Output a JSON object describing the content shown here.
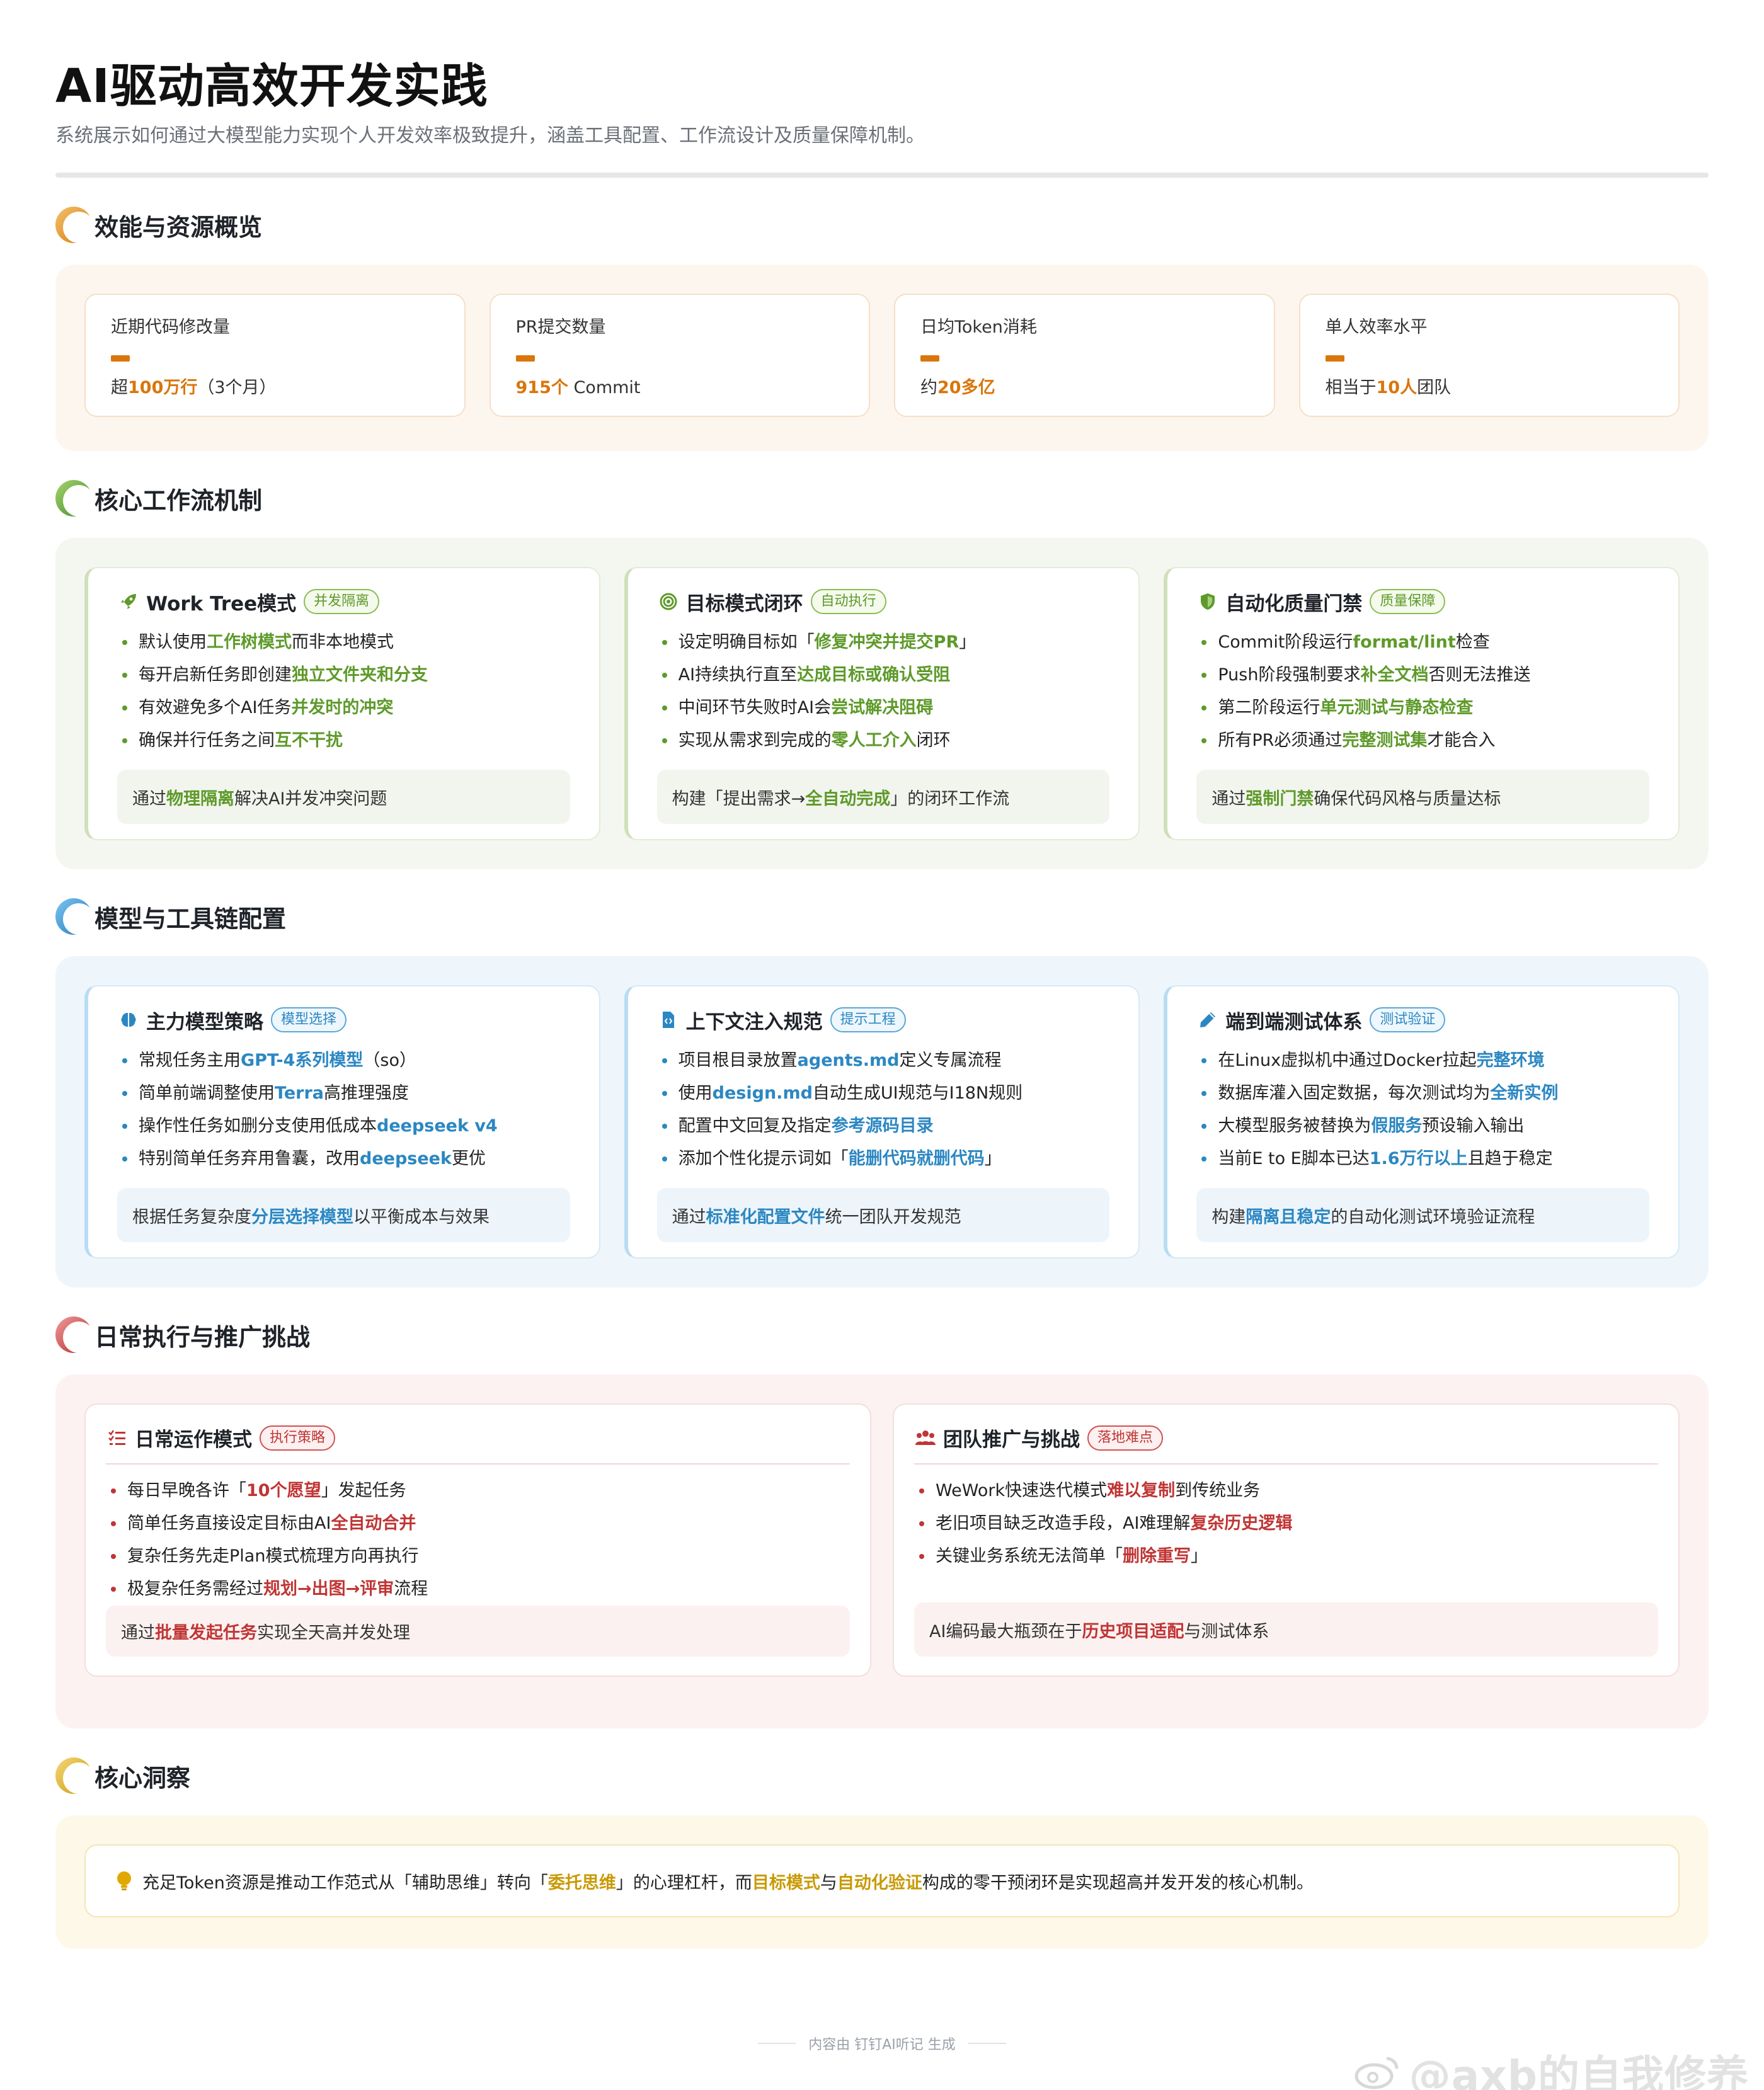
{
  "header": {
    "title": "AI驱动高效开发实践",
    "subtitle": "系统展示如何通过大模型能力实现个人开发效率极致提升，涵盖工具配置、工作流设计及质量保障机制。"
  },
  "sections": {
    "overview": {
      "title": "效能与资源概览",
      "stats": [
        {
          "label": "近期代码修改量",
          "pre": "超",
          "hl": "100万行",
          "post": "（3个月）"
        },
        {
          "label": "PR提交数量",
          "pre": "",
          "hl": "915个",
          "post": " Commit"
        },
        {
          "label": "日均Token消耗",
          "pre": "约",
          "hl": "20多亿",
          "post": ""
        },
        {
          "label": "单人效率水平",
          "pre": "相当于",
          "hl": "10人",
          "post": "团队"
        }
      ]
    },
    "workflow": {
      "title": "核心工作流机制",
      "cards": [
        {
          "icon": "rocket-icon",
          "title": "Work Tree模式",
          "tag": "并发隔离",
          "items": [
            [
              "默认使用",
              "工作树模式",
              "而非本地模式"
            ],
            [
              "每开启新任务即创建",
              "独立文件夹和分支",
              ""
            ],
            [
              "有效避免多个AI任务",
              "并发时的冲突",
              ""
            ],
            [
              "确保并行任务之间",
              "互不干扰",
              ""
            ]
          ],
          "note": [
            "通过",
            "物理隔离",
            "解决AI并发冲突问题"
          ]
        },
        {
          "icon": "target-icon",
          "title": "目标模式闭环",
          "tag": "自动执行",
          "items": [
            [
              "设定明确目标如「",
              "修复冲突并提交PR",
              "」"
            ],
            [
              "AI持续执行直至",
              "达成目标或确认受阻",
              ""
            ],
            [
              "中间环节失败时AI会",
              "尝试解决阻碍",
              ""
            ],
            [
              "实现从需求到完成的",
              "零人工介入",
              "闭环"
            ]
          ],
          "note": [
            "构建「提出需求→",
            "全自动完成",
            "」的闭环工作流"
          ]
        },
        {
          "icon": "shield-icon",
          "title": "自动化质量门禁",
          "tag": "质量保障",
          "items": [
            [
              "Commit阶段运行",
              "format/lint",
              "检查"
            ],
            [
              "Push阶段强制要求",
              "补全文档",
              "否则无法推送"
            ],
            [
              "第二阶段运行",
              "单元测试与静态检查",
              ""
            ],
            [
              "所有PR必须通过",
              "完整测试集",
              "才能合入"
            ]
          ],
          "note": [
            "通过",
            "强制门禁",
            "确保代码风格与质量达标"
          ]
        }
      ]
    },
    "toolchain": {
      "title": "模型与工具链配置",
      "cards": [
        {
          "icon": "brain-icon",
          "title": "主力模型策略",
          "tag": "模型选择",
          "items": [
            [
              "常规任务主用",
              "GPT-4系列模型",
              "（so）"
            ],
            [
              "简单前端调整使用",
              "Terra",
              "高推理强度"
            ],
            [
              "操作性任务如删分支使用低成本",
              "deepseek v4",
              ""
            ],
            [
              "特别简单任务弃用鲁囊，改用",
              "deepseek",
              "更优"
            ]
          ],
          "note": [
            "根据任务复杂度",
            "分层选择模型",
            "以平衡成本与效果"
          ]
        },
        {
          "icon": "file-code-icon",
          "title": "上下文注入规范",
          "tag": "提示工程",
          "items": [
            [
              "项目根目录放置",
              "agents.md",
              "定义专属流程"
            ],
            [
              "使用",
              "design.md",
              "自动生成UI规范与I18N规则"
            ],
            [
              "配置中文回复及指定",
              "参考源码目录",
              ""
            ],
            [
              "添加个性化提示词如「",
              "能删代码就删代码",
              "」"
            ]
          ],
          "note": [
            "通过",
            "标准化配置文件",
            "统一团队开发规范"
          ]
        },
        {
          "icon": "pen-icon",
          "title": "端到端测试体系",
          "tag": "测试验证",
          "items": [
            [
              "在Linux虚拟机中通过Docker拉起",
              "完整环境",
              ""
            ],
            [
              "数据库灌入固定数据，每次测试均为",
              "全新实例",
              ""
            ],
            [
              "大模型服务被替换为",
              "假服务",
              "预设输入输出"
            ],
            [
              "当前E to E脚本已达",
              "1.6万行以上",
              "且趋于稳定"
            ]
          ],
          "note": [
            "构建",
            "隔离且稳定",
            "的自动化测试环境验证流程"
          ]
        }
      ]
    },
    "execution": {
      "title": "日常执行与推广挑战",
      "cards": [
        {
          "icon": "checklist-icon",
          "title": "日常运作模式",
          "tag": "执行策略",
          "items": [
            [
              "每日早晚各许「",
              "10个愿望",
              "」发起任务"
            ],
            [
              "简单任务直接设定目标由AI",
              "全自动合并",
              ""
            ],
            [
              "复杂任务先走Plan模式梳理方向再执行",
              "",
              ""
            ],
            [
              "极复杂任务需经过",
              "规划→出图→评审",
              "流程"
            ]
          ],
          "note": [
            "通过",
            "批量发起任务",
            "实现全天高并发处理"
          ]
        },
        {
          "icon": "team-icon",
          "title": "团队推广与挑战",
          "tag": "落地难点",
          "items": [
            [
              "WeWork快速迭代模式",
              "难以复制",
              "到传统业务"
            ],
            [
              "老旧项目缺乏改造手段，AI难理解",
              "复杂历史逻辑",
              ""
            ],
            [
              "关键业务系统无法简单「",
              "删除重写",
              "」"
            ]
          ],
          "note": [
            "AI编码最大瓶颈在于",
            "历史项目适配",
            "与测试体系"
          ]
        }
      ]
    },
    "insight": {
      "title": "核心洞察",
      "parts": [
        "充足Token资源是推动工作范式从「辅助思维」转向「",
        "委托思维",
        "」的心理杠杆，而",
        "目标模式",
        "与",
        "自动化验证",
        "构成的零干预闭环是实现超高并发开发的核心机制。"
      ]
    }
  },
  "footer": {
    "text": "内容由 钉钉AI听记 生成"
  },
  "watermark": {
    "text": "@axb的自我修养"
  },
  "colors": {
    "orange": "#d9760c",
    "green": "#5e9a2a",
    "blue": "#2b87c2",
    "red": "#c03535",
    "yellow": "#c99a06"
  }
}
